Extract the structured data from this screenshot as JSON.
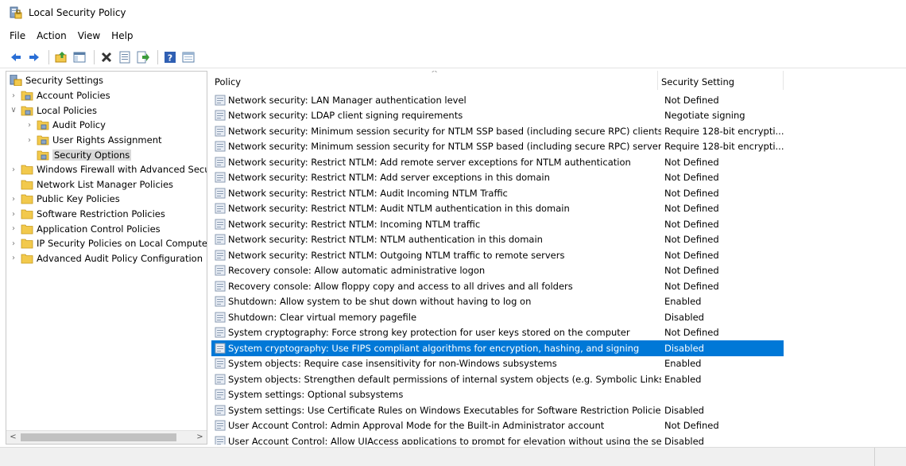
{
  "window": {
    "title": "Local Security Policy"
  },
  "menu": [
    "File",
    "Action",
    "View",
    "Help"
  ],
  "toolbar": {
    "buttons": [
      "back-arrow-icon",
      "forward-arrow-icon",
      "up-folder-icon",
      "show-hide-tree-icon",
      "delete-icon",
      "properties-icon",
      "export-list-icon",
      "help-icon",
      "console-view-icon"
    ]
  },
  "tree": {
    "root": "Security Settings",
    "items": [
      {
        "label": "Account Policies",
        "arrow": ">",
        "level": 1
      },
      {
        "label": "Local Policies",
        "arrow": "v",
        "level": 1
      },
      {
        "label": "Audit Policy",
        "arrow": ">",
        "level": 2
      },
      {
        "label": "User Rights Assignment",
        "arrow": ">",
        "level": 2
      },
      {
        "label": "Security Options",
        "arrow": "",
        "level": 2,
        "selected": true
      },
      {
        "label": "Windows Firewall with Advanced Secu",
        "arrow": ">",
        "level": 1
      },
      {
        "label": "Network List Manager Policies",
        "arrow": "",
        "level": 1
      },
      {
        "label": "Public Key Policies",
        "arrow": ">",
        "level": 1
      },
      {
        "label": "Software Restriction Policies",
        "arrow": ">",
        "level": 1
      },
      {
        "label": "Application Control Policies",
        "arrow": ">",
        "level": 1
      },
      {
        "label": "IP Security Policies on Local Compute",
        "arrow": ">",
        "level": 1
      },
      {
        "label": "Advanced Audit Policy Configuration",
        "arrow": ">",
        "level": 1
      }
    ]
  },
  "list": {
    "columns": {
      "policy": "Policy",
      "setting": "Security Setting"
    },
    "rows": [
      {
        "policy": "Network security: LAN Manager authentication level",
        "setting": "Not Defined"
      },
      {
        "policy": "Network security: LDAP client signing requirements",
        "setting": "Negotiate signing"
      },
      {
        "policy": "Network security: Minimum session security for NTLM SSP based (including secure RPC) clients",
        "setting": "Require 128-bit encrypti..."
      },
      {
        "policy": "Network security: Minimum session security for NTLM SSP based (including secure RPC) servers",
        "setting": "Require 128-bit encrypti..."
      },
      {
        "policy": "Network security: Restrict NTLM: Add remote server exceptions for NTLM authentication",
        "setting": "Not Defined"
      },
      {
        "policy": "Network security: Restrict NTLM: Add server exceptions in this domain",
        "setting": "Not Defined"
      },
      {
        "policy": "Network security: Restrict NTLM: Audit Incoming NTLM Traffic",
        "setting": "Not Defined"
      },
      {
        "policy": "Network security: Restrict NTLM: Audit NTLM authentication in this domain",
        "setting": "Not Defined"
      },
      {
        "policy": "Network security: Restrict NTLM: Incoming NTLM traffic",
        "setting": "Not Defined"
      },
      {
        "policy": "Network security: Restrict NTLM: NTLM authentication in this domain",
        "setting": "Not Defined"
      },
      {
        "policy": "Network security: Restrict NTLM: Outgoing NTLM traffic to remote servers",
        "setting": "Not Defined"
      },
      {
        "policy": "Recovery console: Allow automatic administrative logon",
        "setting": "Not Defined"
      },
      {
        "policy": "Recovery console: Allow floppy copy and access to all drives and all folders",
        "setting": "Not Defined"
      },
      {
        "policy": "Shutdown: Allow system to be shut down without having to log on",
        "setting": "Enabled"
      },
      {
        "policy": "Shutdown: Clear virtual memory pagefile",
        "setting": "Disabled"
      },
      {
        "policy": "System cryptography: Force strong key protection for user keys stored on the computer",
        "setting": "Not Defined"
      },
      {
        "policy": "System cryptography: Use FIPS compliant algorithms for encryption, hashing, and signing",
        "setting": "Disabled",
        "selected": true
      },
      {
        "policy": "System objects: Require case insensitivity for non-Windows subsystems",
        "setting": "Enabled"
      },
      {
        "policy": "System objects: Strengthen default permissions of internal system objects (e.g. Symbolic Links)",
        "setting": "Enabled"
      },
      {
        "policy": "System settings: Optional subsystems",
        "setting": ""
      },
      {
        "policy": "System settings: Use Certificate Rules on Windows Executables for Software Restriction Policies",
        "setting": "Disabled"
      },
      {
        "policy": "User Account Control: Admin Approval Mode for the Built-in Administrator account",
        "setting": "Not Defined"
      },
      {
        "policy": "User Account Control: Allow UIAccess applications to prompt for elevation without using the sec...",
        "setting": "Disabled"
      }
    ]
  },
  "colors": {
    "selection": "#0078d7",
    "tree_selection": "#d9d9d9"
  }
}
